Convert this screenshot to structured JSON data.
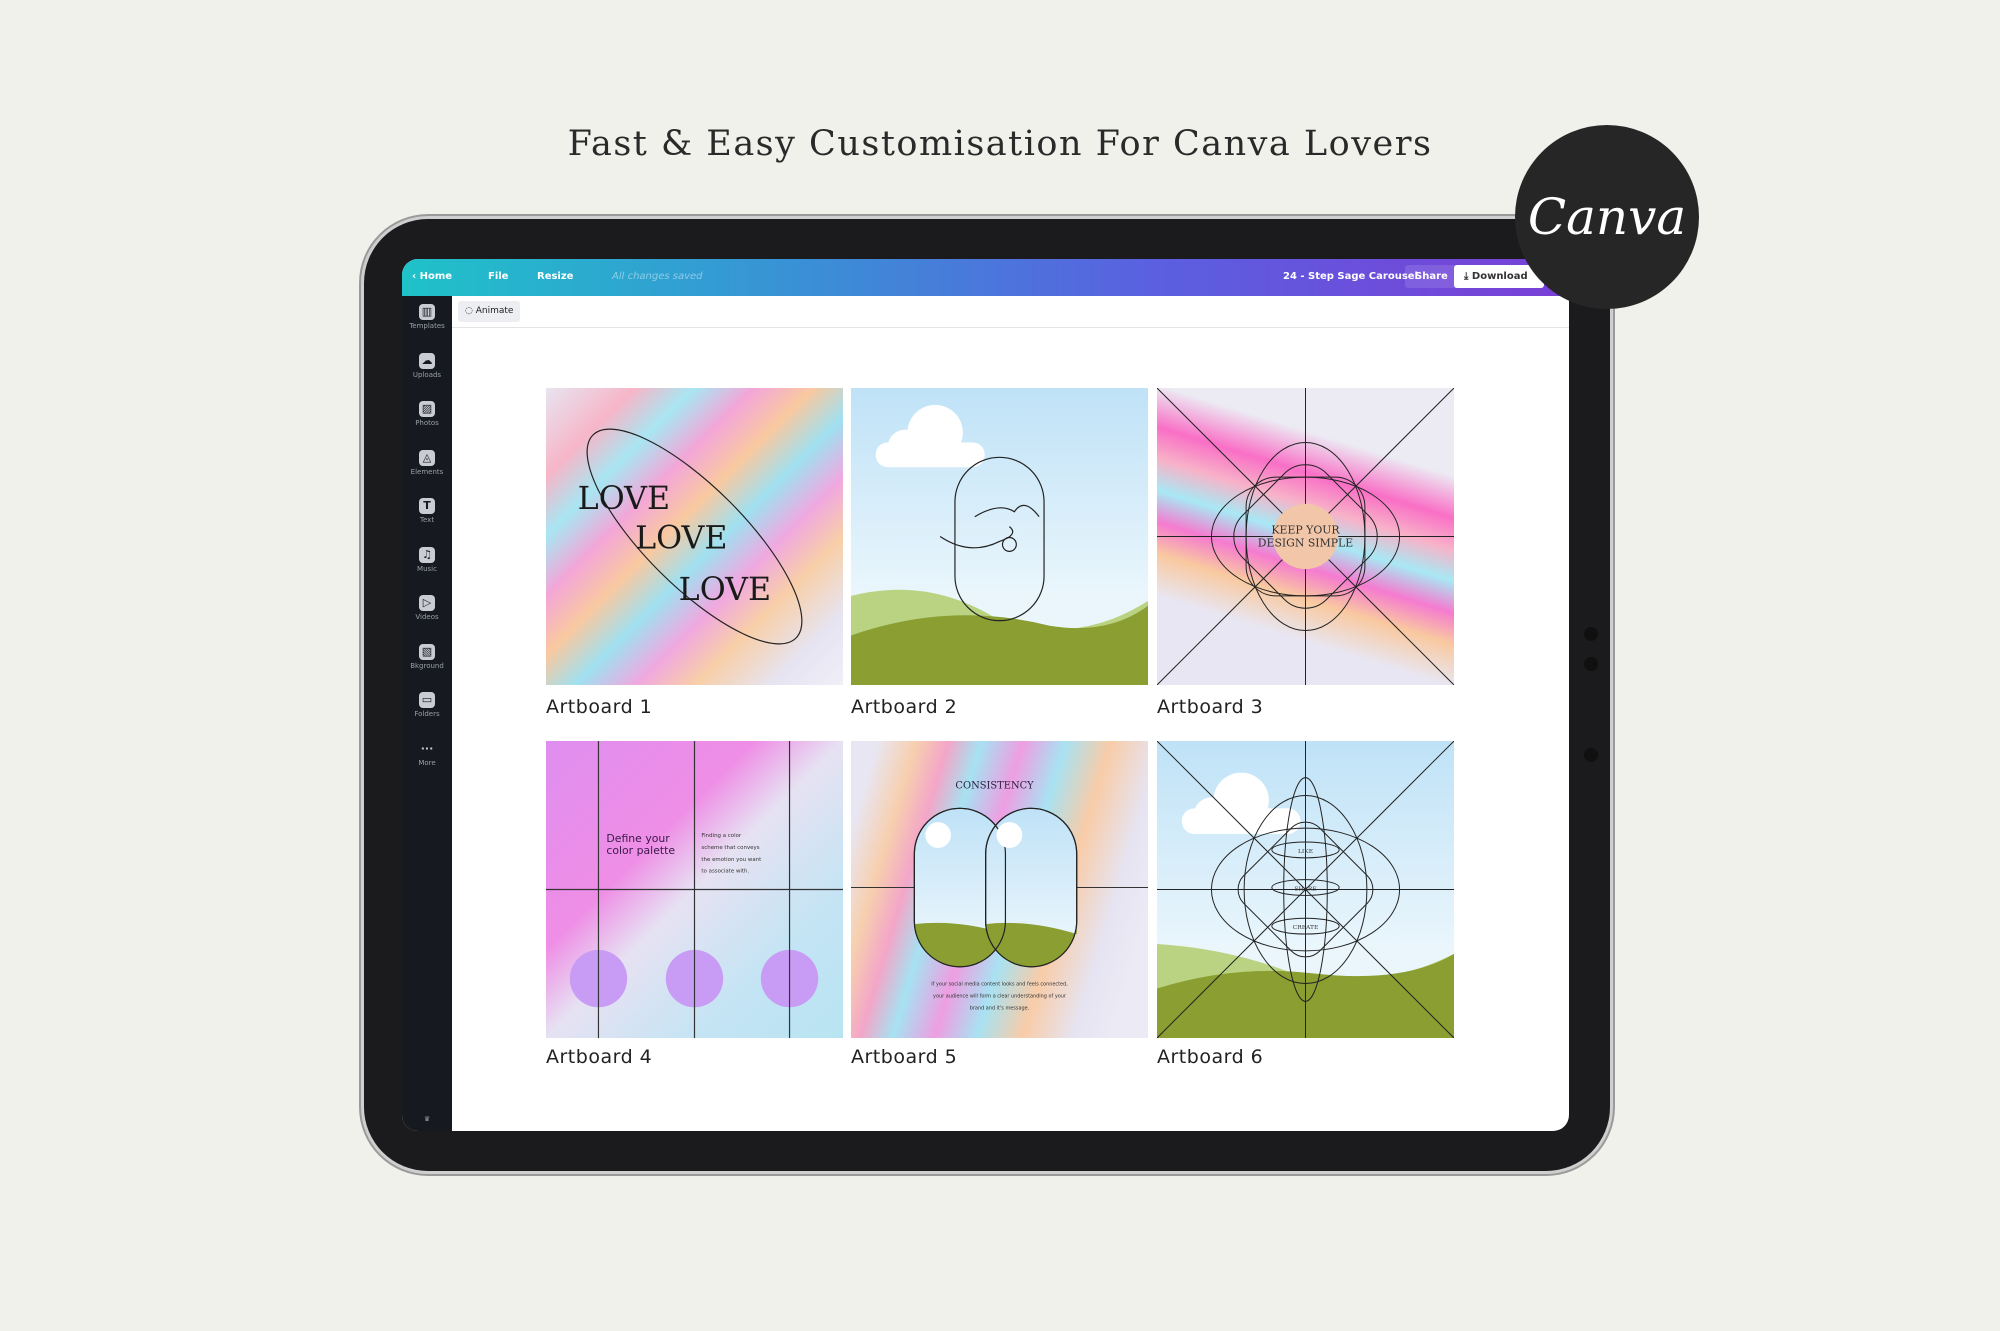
{
  "headline": "Fast & Easy Customisation For Canva Lovers",
  "badge": {
    "logo_text": "Canva"
  },
  "topbar": {
    "home": "Home",
    "file": "File",
    "resize": "Resize",
    "status": "All changes saved",
    "design_title": "24 - Step Sage Carousel",
    "share": "Share",
    "download": "Download"
  },
  "toolbar": {
    "animate": "Animate"
  },
  "sidebar": {
    "items": [
      {
        "label": "Templates",
        "icon": "templates-icon"
      },
      {
        "label": "Uploads",
        "icon": "upload-cloud-icon"
      },
      {
        "label": "Photos",
        "icon": "photo-icon"
      },
      {
        "label": "Elements",
        "icon": "shapes-icon"
      },
      {
        "label": "Text",
        "icon": "text-icon"
      },
      {
        "label": "Music",
        "icon": "music-note-icon"
      },
      {
        "label": "Videos",
        "icon": "play-icon"
      },
      {
        "label": "Bkground",
        "icon": "background-pattern-icon"
      },
      {
        "label": "Folders",
        "icon": "folder-icon"
      },
      {
        "label": "More",
        "icon": "more-dots-icon"
      }
    ]
  },
  "artboards": [
    {
      "label": "Artboard 1",
      "texts": [
        "LOVE",
        "LOVE",
        "LOVE"
      ]
    },
    {
      "label": "Artboard 2"
    },
    {
      "label": "Artboard 3",
      "texts": [
        "KEEP YOUR",
        "DESIGN SIMPLE"
      ]
    },
    {
      "label": "Artboard 4",
      "texts": [
        "Define your",
        "color palette",
        "Finding a color",
        "scheme that conveys",
        "the emotion you want",
        "to associate with."
      ]
    },
    {
      "label": "Artboard 5",
      "texts": [
        "CONSISTENCY",
        "If your social media content looks and feels connected,",
        "your audience will form a clear understanding of your",
        "brand and it's message."
      ]
    },
    {
      "label": "Artboard 6",
      "texts": [
        "LIKE",
        "SHARE",
        "CREATE"
      ]
    }
  ],
  "colors": {
    "topbar_start": "#1fc2c9",
    "topbar_end": "#7a3fd6",
    "sidebar": "#16191f",
    "hill": "#8a9e32",
    "circle_purple": "#c89cf5"
  }
}
